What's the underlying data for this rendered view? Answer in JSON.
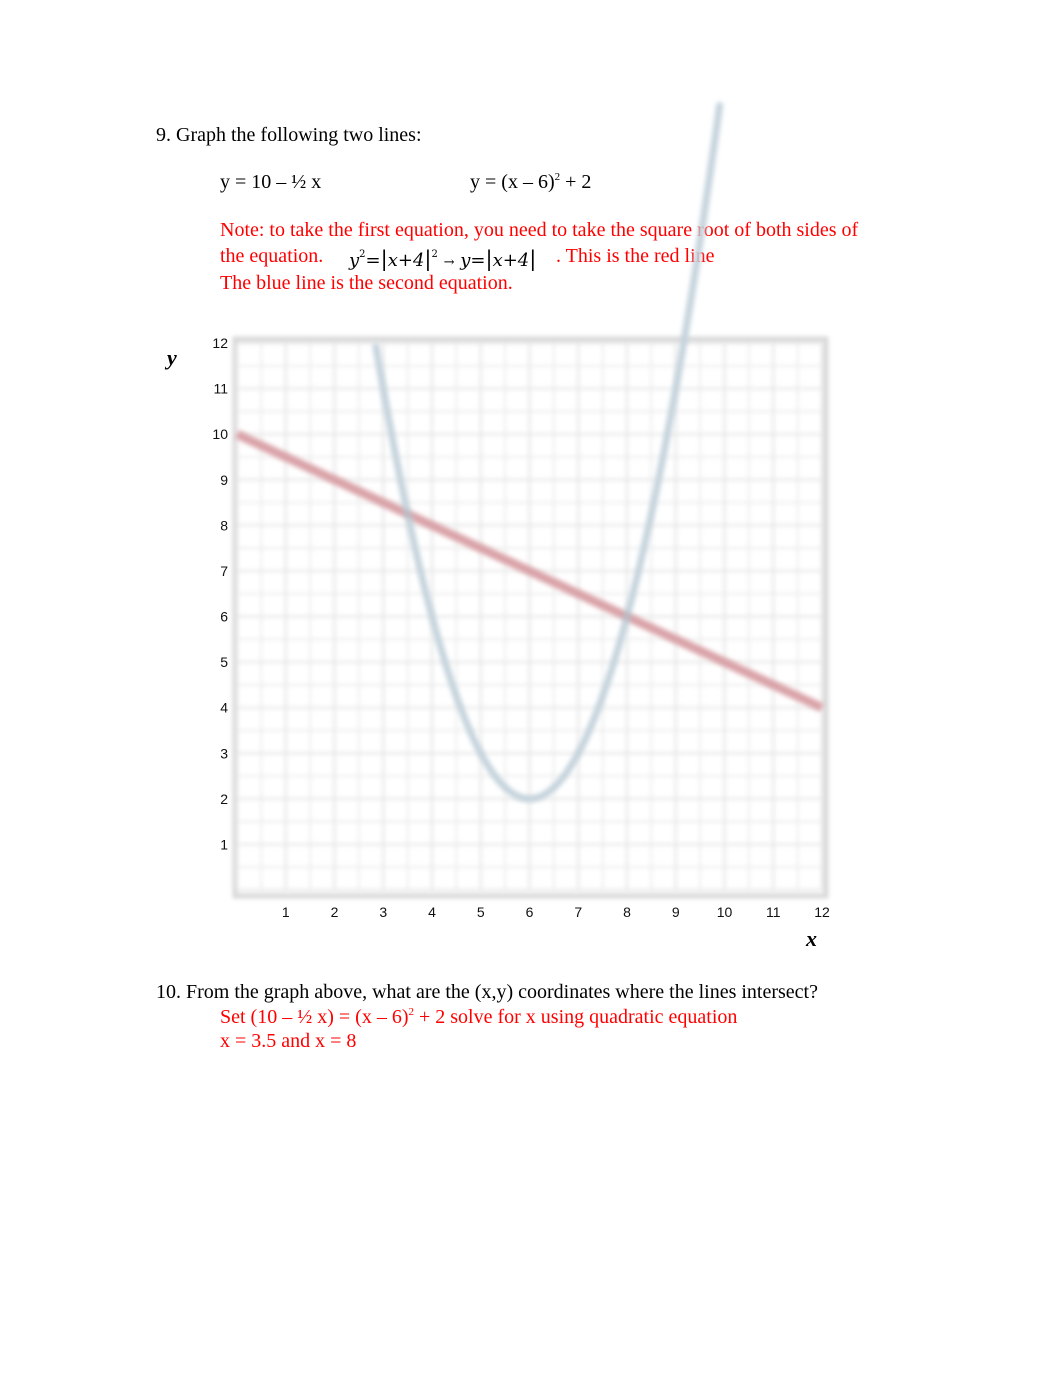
{
  "question9": {
    "title": "9. Graph the following two lines:",
    "equation1": "y = 10 – ½ x",
    "equation2_base": "y = (x – 6)",
    "equation2_exp": "2",
    "equation2_tail": " + 2",
    "note_line1": "Note: to take the first equation, you need to take the square root of both sides of",
    "note_line2_prefix": "the equation.",
    "note_math": {
      "lhs_var": "y",
      "lhs_exp": "2",
      "eq": "=",
      "open": "|",
      "inner": "x+4",
      "close": "|",
      "inner_exp": "2",
      "arrow": "→",
      "rhs_var": "y",
      "rhs_eq": "=",
      "rhs_inner": "x+4"
    },
    "note_line2_suffix": ". This is the red line",
    "note_line3": "The blue line is the second equation."
  },
  "chart_data": {
    "type": "line",
    "title": "",
    "xlabel": "x",
    "ylabel": "y",
    "xlim": [
      0,
      12
    ],
    "ylim": [
      0,
      12
    ],
    "grid": true,
    "x_ticks": [
      "1",
      "2",
      "3",
      "4",
      "5",
      "6",
      "7",
      "8",
      "9",
      "10",
      "11",
      "12"
    ],
    "y_ticks": [
      "1",
      "2",
      "3",
      "4",
      "5",
      "6",
      "7",
      "8",
      "9",
      "10",
      "11",
      "12"
    ],
    "series": [
      {
        "name": "y = 10 – ½ x",
        "color": "#d9a3a8",
        "kind": "linear",
        "x": [
          0,
          12
        ],
        "y": [
          10,
          4
        ]
      },
      {
        "name": "y = (x – 6)^2 + 2",
        "color": "#c4d3dc",
        "kind": "parabola",
        "x": [
          2.5,
          3,
          3.5,
          4,
          4.5,
          5,
          5.5,
          6,
          6.5,
          7,
          7.5,
          8,
          8.5,
          9,
          9.5,
          10
        ],
        "y": [
          14.25,
          11,
          8.25,
          6,
          4.25,
          3,
          2.25,
          2,
          2.25,
          3,
          4.25,
          6,
          8.25,
          11,
          14.25,
          18
        ]
      }
    ],
    "intersections": [
      {
        "x": 3.5,
        "y": 8.25
      },
      {
        "x": 8,
        "y": 6
      }
    ]
  },
  "question10": {
    "title": "10. From the graph above, what are the (x,y) coordinates where the lines intersect?",
    "answer_line1_prefix": "Set (10 – ½ x) = (x – 6)",
    "answer_line1_exp": "2",
    "answer_line1_suffix": " + 2 solve for x using quadratic equation",
    "answer_line2": "x = 3.5 and x = 8"
  },
  "colors": {
    "answer_text": "#ff0000",
    "grid": "#e6e6e6",
    "red_line": "#d9a3a8",
    "blue_curve": "#c4d3dc"
  }
}
